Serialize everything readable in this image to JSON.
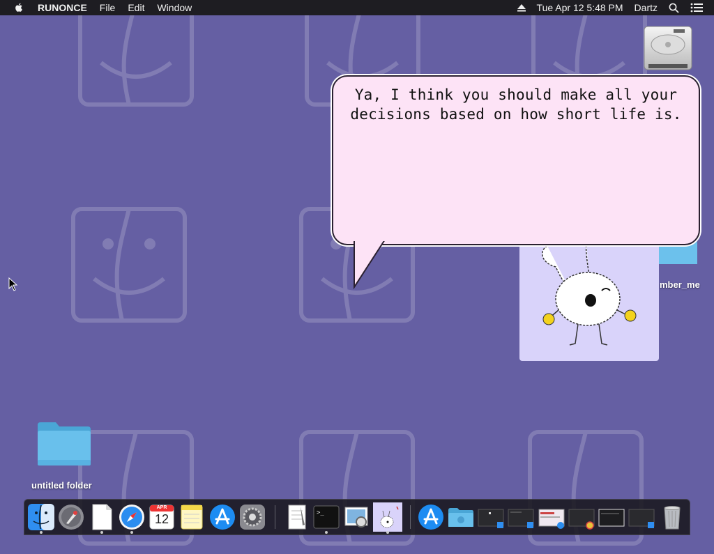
{
  "menubar": {
    "app_name": "RUNONCE",
    "menus": [
      "File",
      "Edit",
      "Window"
    ],
    "datetime": "Tue Apr 12  5:48 PM",
    "user": "Dartz"
  },
  "desktop": {
    "folder_label": "untitled folder",
    "partial_label": "mber_me"
  },
  "bubble": {
    "line1": "Ya, I think you should make all your",
    "line2": "decisions based on how short life is."
  },
  "dock": {
    "calendar_month": "APR",
    "calendar_day": "12",
    "items": [
      "finder",
      "launchpad",
      "document",
      "safari",
      "calendar",
      "notes",
      "app-store",
      "system-preferences",
      "textedit",
      "terminal",
      "preview",
      "runonce",
      "app-store-2",
      "folder",
      "window-1",
      "window-2",
      "window-3",
      "window-4",
      "window-5",
      "window-6",
      "trash"
    ]
  },
  "colors": {
    "wallpaper": "#655fa3",
    "bubble": "#fde3f6",
    "character_window": "#d9d3fa"
  }
}
